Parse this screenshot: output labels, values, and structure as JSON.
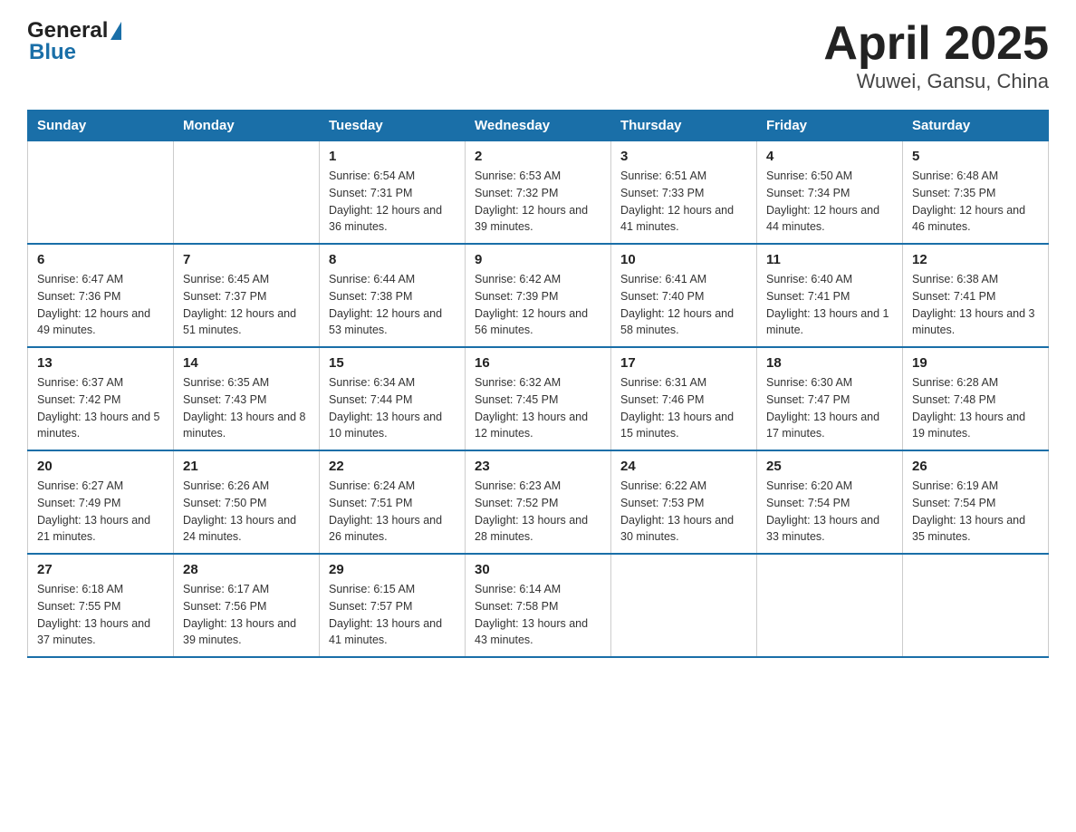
{
  "header": {
    "logo_text_general": "General",
    "logo_text_blue": "Blue",
    "title": "April 2025",
    "subtitle": "Wuwei, Gansu, China"
  },
  "days_of_week": [
    "Sunday",
    "Monday",
    "Tuesday",
    "Wednesday",
    "Thursday",
    "Friday",
    "Saturday"
  ],
  "weeks": [
    [
      {
        "day": "",
        "sunrise": "",
        "sunset": "",
        "daylight": ""
      },
      {
        "day": "",
        "sunrise": "",
        "sunset": "",
        "daylight": ""
      },
      {
        "day": "1",
        "sunrise": "Sunrise: 6:54 AM",
        "sunset": "Sunset: 7:31 PM",
        "daylight": "Daylight: 12 hours and 36 minutes."
      },
      {
        "day": "2",
        "sunrise": "Sunrise: 6:53 AM",
        "sunset": "Sunset: 7:32 PM",
        "daylight": "Daylight: 12 hours and 39 minutes."
      },
      {
        "day": "3",
        "sunrise": "Sunrise: 6:51 AM",
        "sunset": "Sunset: 7:33 PM",
        "daylight": "Daylight: 12 hours and 41 minutes."
      },
      {
        "day": "4",
        "sunrise": "Sunrise: 6:50 AM",
        "sunset": "Sunset: 7:34 PM",
        "daylight": "Daylight: 12 hours and 44 minutes."
      },
      {
        "day": "5",
        "sunrise": "Sunrise: 6:48 AM",
        "sunset": "Sunset: 7:35 PM",
        "daylight": "Daylight: 12 hours and 46 minutes."
      }
    ],
    [
      {
        "day": "6",
        "sunrise": "Sunrise: 6:47 AM",
        "sunset": "Sunset: 7:36 PM",
        "daylight": "Daylight: 12 hours and 49 minutes."
      },
      {
        "day": "7",
        "sunrise": "Sunrise: 6:45 AM",
        "sunset": "Sunset: 7:37 PM",
        "daylight": "Daylight: 12 hours and 51 minutes."
      },
      {
        "day": "8",
        "sunrise": "Sunrise: 6:44 AM",
        "sunset": "Sunset: 7:38 PM",
        "daylight": "Daylight: 12 hours and 53 minutes."
      },
      {
        "day": "9",
        "sunrise": "Sunrise: 6:42 AM",
        "sunset": "Sunset: 7:39 PM",
        "daylight": "Daylight: 12 hours and 56 minutes."
      },
      {
        "day": "10",
        "sunrise": "Sunrise: 6:41 AM",
        "sunset": "Sunset: 7:40 PM",
        "daylight": "Daylight: 12 hours and 58 minutes."
      },
      {
        "day": "11",
        "sunrise": "Sunrise: 6:40 AM",
        "sunset": "Sunset: 7:41 PM",
        "daylight": "Daylight: 13 hours and 1 minute."
      },
      {
        "day": "12",
        "sunrise": "Sunrise: 6:38 AM",
        "sunset": "Sunset: 7:41 PM",
        "daylight": "Daylight: 13 hours and 3 minutes."
      }
    ],
    [
      {
        "day": "13",
        "sunrise": "Sunrise: 6:37 AM",
        "sunset": "Sunset: 7:42 PM",
        "daylight": "Daylight: 13 hours and 5 minutes."
      },
      {
        "day": "14",
        "sunrise": "Sunrise: 6:35 AM",
        "sunset": "Sunset: 7:43 PM",
        "daylight": "Daylight: 13 hours and 8 minutes."
      },
      {
        "day": "15",
        "sunrise": "Sunrise: 6:34 AM",
        "sunset": "Sunset: 7:44 PM",
        "daylight": "Daylight: 13 hours and 10 minutes."
      },
      {
        "day": "16",
        "sunrise": "Sunrise: 6:32 AM",
        "sunset": "Sunset: 7:45 PM",
        "daylight": "Daylight: 13 hours and 12 minutes."
      },
      {
        "day": "17",
        "sunrise": "Sunrise: 6:31 AM",
        "sunset": "Sunset: 7:46 PM",
        "daylight": "Daylight: 13 hours and 15 minutes."
      },
      {
        "day": "18",
        "sunrise": "Sunrise: 6:30 AM",
        "sunset": "Sunset: 7:47 PM",
        "daylight": "Daylight: 13 hours and 17 minutes."
      },
      {
        "day": "19",
        "sunrise": "Sunrise: 6:28 AM",
        "sunset": "Sunset: 7:48 PM",
        "daylight": "Daylight: 13 hours and 19 minutes."
      }
    ],
    [
      {
        "day": "20",
        "sunrise": "Sunrise: 6:27 AM",
        "sunset": "Sunset: 7:49 PM",
        "daylight": "Daylight: 13 hours and 21 minutes."
      },
      {
        "day": "21",
        "sunrise": "Sunrise: 6:26 AM",
        "sunset": "Sunset: 7:50 PM",
        "daylight": "Daylight: 13 hours and 24 minutes."
      },
      {
        "day": "22",
        "sunrise": "Sunrise: 6:24 AM",
        "sunset": "Sunset: 7:51 PM",
        "daylight": "Daylight: 13 hours and 26 minutes."
      },
      {
        "day": "23",
        "sunrise": "Sunrise: 6:23 AM",
        "sunset": "Sunset: 7:52 PM",
        "daylight": "Daylight: 13 hours and 28 minutes."
      },
      {
        "day": "24",
        "sunrise": "Sunrise: 6:22 AM",
        "sunset": "Sunset: 7:53 PM",
        "daylight": "Daylight: 13 hours and 30 minutes."
      },
      {
        "day": "25",
        "sunrise": "Sunrise: 6:20 AM",
        "sunset": "Sunset: 7:54 PM",
        "daylight": "Daylight: 13 hours and 33 minutes."
      },
      {
        "day": "26",
        "sunrise": "Sunrise: 6:19 AM",
        "sunset": "Sunset: 7:54 PM",
        "daylight": "Daylight: 13 hours and 35 minutes."
      }
    ],
    [
      {
        "day": "27",
        "sunrise": "Sunrise: 6:18 AM",
        "sunset": "Sunset: 7:55 PM",
        "daylight": "Daylight: 13 hours and 37 minutes."
      },
      {
        "day": "28",
        "sunrise": "Sunrise: 6:17 AM",
        "sunset": "Sunset: 7:56 PM",
        "daylight": "Daylight: 13 hours and 39 minutes."
      },
      {
        "day": "29",
        "sunrise": "Sunrise: 6:15 AM",
        "sunset": "Sunset: 7:57 PM",
        "daylight": "Daylight: 13 hours and 41 minutes."
      },
      {
        "day": "30",
        "sunrise": "Sunrise: 6:14 AM",
        "sunset": "Sunset: 7:58 PM",
        "daylight": "Daylight: 13 hours and 43 minutes."
      },
      {
        "day": "",
        "sunrise": "",
        "sunset": "",
        "daylight": ""
      },
      {
        "day": "",
        "sunrise": "",
        "sunset": "",
        "daylight": ""
      },
      {
        "day": "",
        "sunrise": "",
        "sunset": "",
        "daylight": ""
      }
    ]
  ]
}
